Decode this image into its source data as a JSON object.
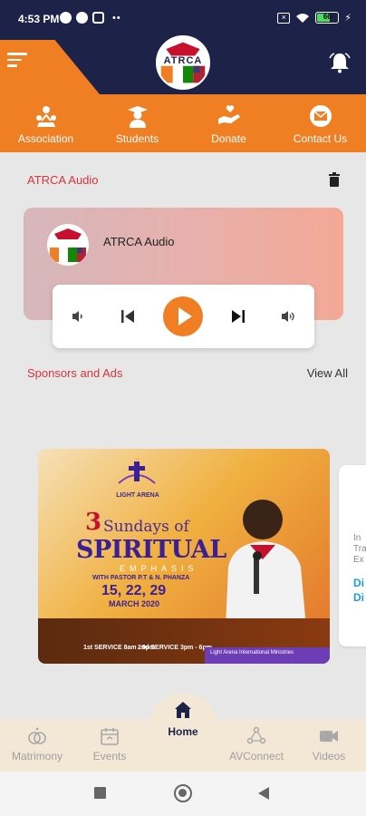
{
  "status_bar": {
    "time": "4:53 PM",
    "more": "••",
    "battery_level": "66",
    "battery_fraction": 0.66
  },
  "header": {
    "logo_text": "ATRCA"
  },
  "actions": [
    {
      "label": "Association",
      "icon": "association-icon"
    },
    {
      "label": "Students",
      "icon": "students-icon"
    },
    {
      "label": "Donate",
      "icon": "donate-icon"
    },
    {
      "label": "Contact Us",
      "icon": "contact-icon"
    }
  ],
  "audio": {
    "section_title": "ATRCA Audio",
    "track_title": "ATRCA Audio"
  },
  "sponsors": {
    "title": "Sponsors and Ads",
    "view_all": "View All"
  },
  "banner": {
    "org": "LIGHT ARENA",
    "number": "3",
    "sundays": "Sundays of",
    "spiritual": "SPIRITUAL",
    "emphasis": "EMPHASIS",
    "with": "WITH PASTOR P.T & N. PHANZA",
    "dates": "15, 22, 29",
    "month": "MARCH 2020",
    "service1": "1st SERVICE 8am - 9pm",
    "service2": "2nd SERVICE 3pm - 6pm",
    "contact": "Light Arena International Ministries"
  },
  "peek_card": {
    "text1": "In\nTra\nEx",
    "text2": "Di\nDi"
  },
  "bottom_nav": {
    "items": [
      "Matrimony",
      "Events",
      "AVConnect",
      "Videos"
    ],
    "home": "Home"
  },
  "colors": {
    "navy": "#1d2249",
    "orange": "#f07e22",
    "accent_red": "#d8343c"
  }
}
